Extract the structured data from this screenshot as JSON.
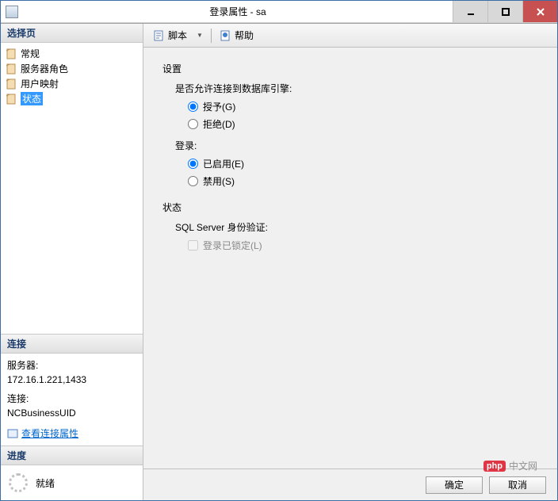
{
  "title": "登录属性 - sa",
  "left": {
    "select_page": "选择页",
    "items": [
      "常规",
      "服务器角色",
      "用户映射",
      "状态"
    ],
    "selected": 3,
    "connection": "连接",
    "server_label": "服务器:",
    "server_value": "172.16.1.221,1433",
    "conn_label": "连接:",
    "conn_value": "NCBusinessUID",
    "view_props": "查看连接属性",
    "progress": "进度",
    "ready": "就绪"
  },
  "toolbar": {
    "script": "脚本",
    "help": "帮助"
  },
  "content": {
    "settings": "设置",
    "allow_connect": "是否允许连接到数据库引擎:",
    "grant": "授予(G)",
    "deny": "拒绝(D)",
    "login": "登录:",
    "enabled": "已启用(E)",
    "disabled": "禁用(S)",
    "status": "状态",
    "sql_auth": "SQL Server 身份验证:",
    "locked": "登录已锁定(L)"
  },
  "footer": {
    "ok": "确定",
    "cancel": "取消"
  },
  "watermark": {
    "logo": "php",
    "text": "中文网"
  }
}
